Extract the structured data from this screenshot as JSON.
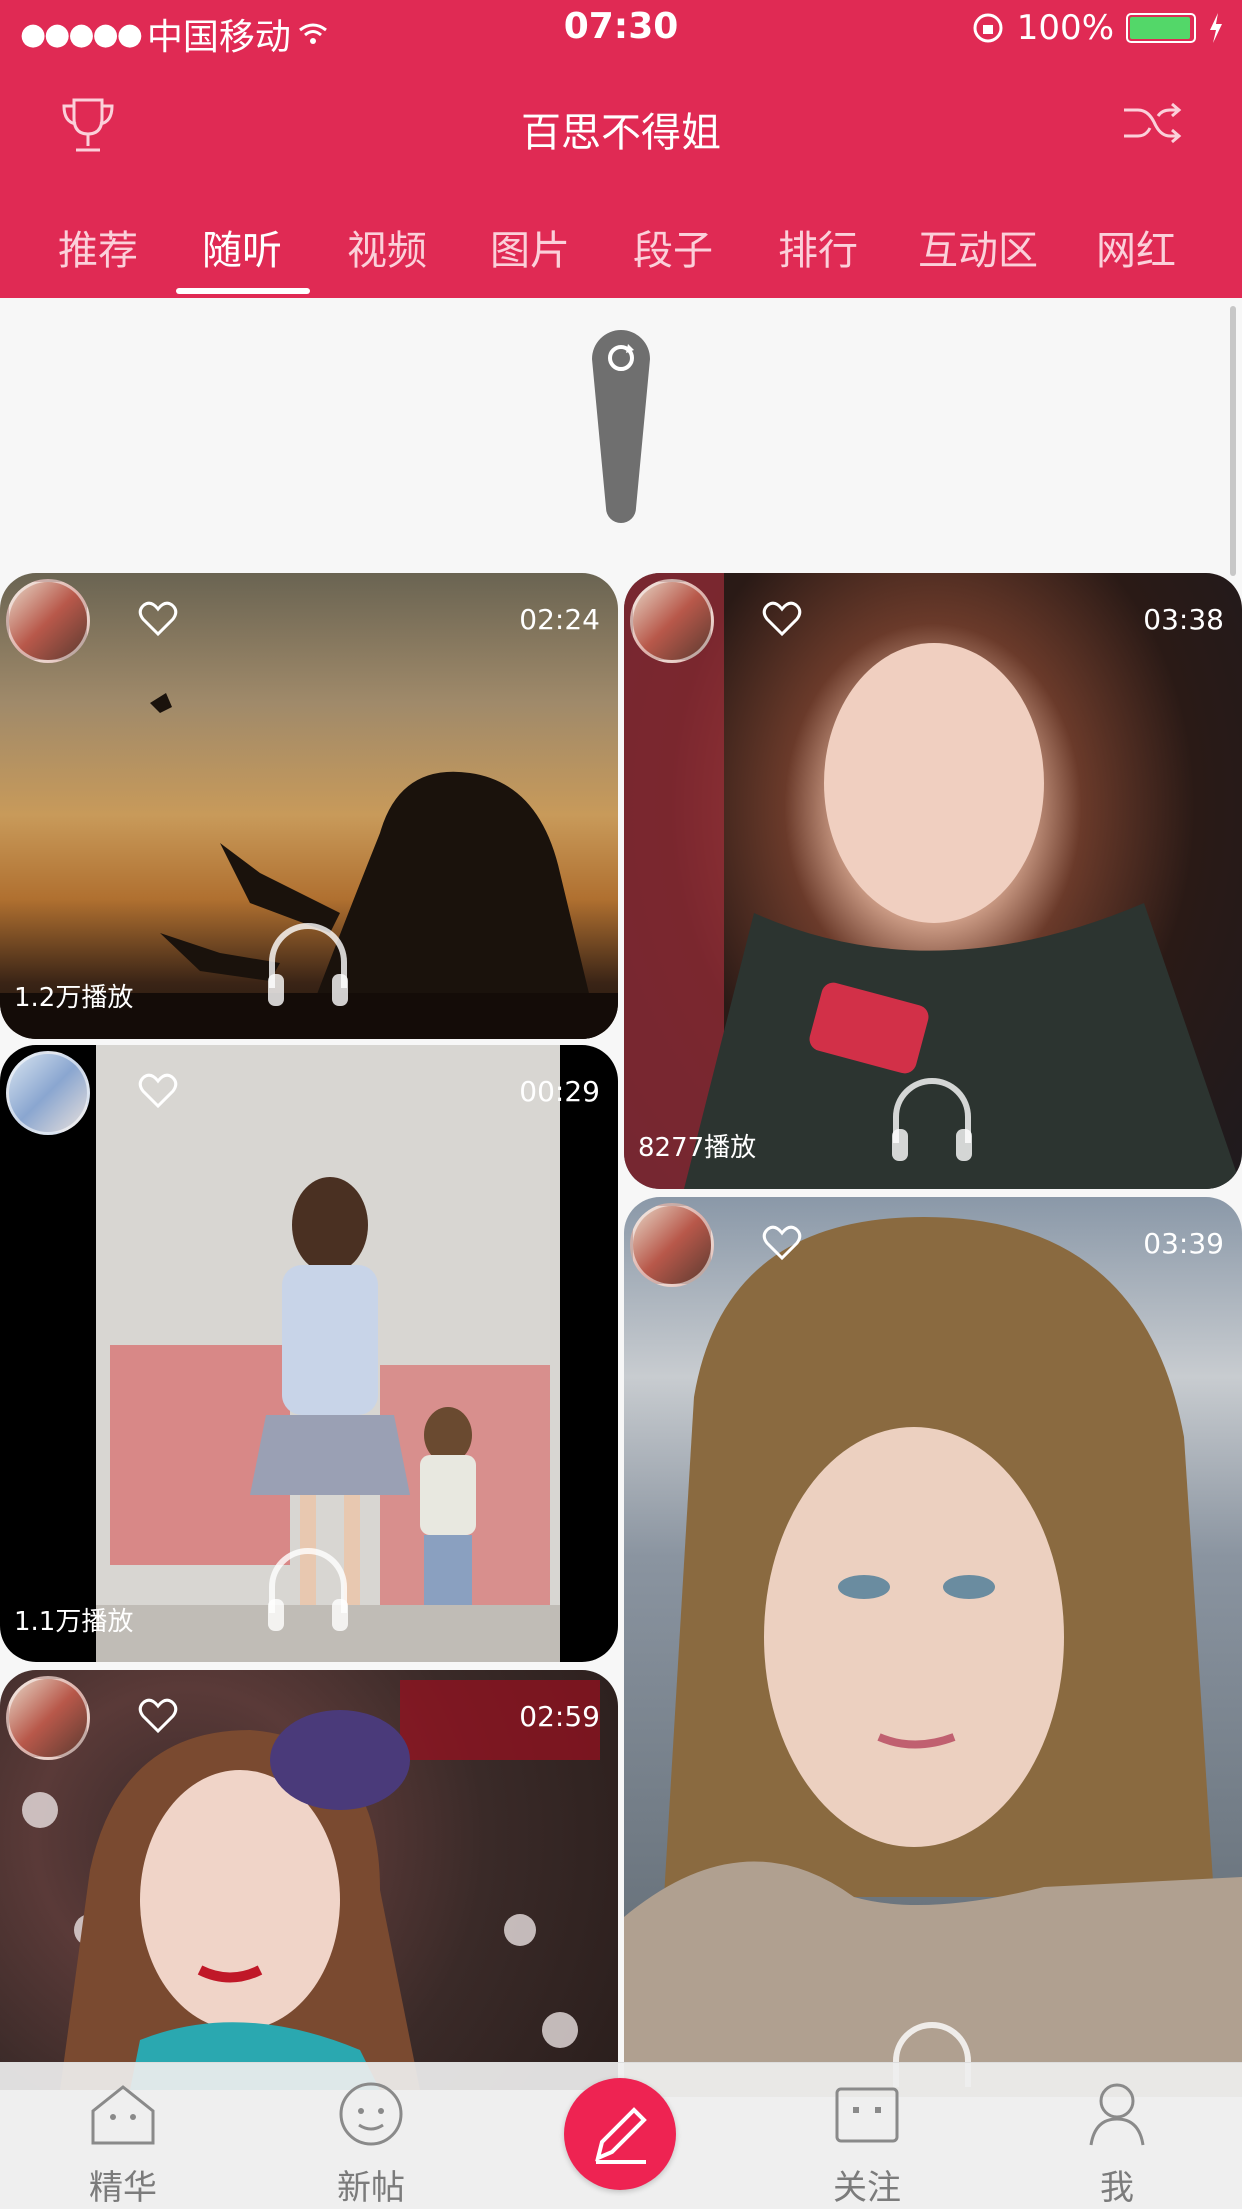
{
  "status": {
    "carrier": "中国移动",
    "time": "07:30",
    "battery": "100%"
  },
  "nav": {
    "title": "百思不得姐"
  },
  "tabs": [
    "推荐",
    "随听",
    "视频",
    "图片",
    "段子",
    "排行",
    "互动区",
    "网红"
  ],
  "active_tab": "随听",
  "cards": [
    {
      "duration": "02:24",
      "plays": "1.2万播放"
    },
    {
      "duration": "03:38",
      "plays": "8277播放"
    },
    {
      "duration": "00:29",
      "plays": "1.1万播放"
    },
    {
      "duration": "03:39",
      "plays": ""
    },
    {
      "duration": "02:59",
      "plays": ""
    }
  ],
  "tabbar": [
    "精华",
    "新帖",
    "关注",
    "我"
  ],
  "colors": {
    "brand": "#e02a54",
    "post_button": "#ee2352"
  }
}
